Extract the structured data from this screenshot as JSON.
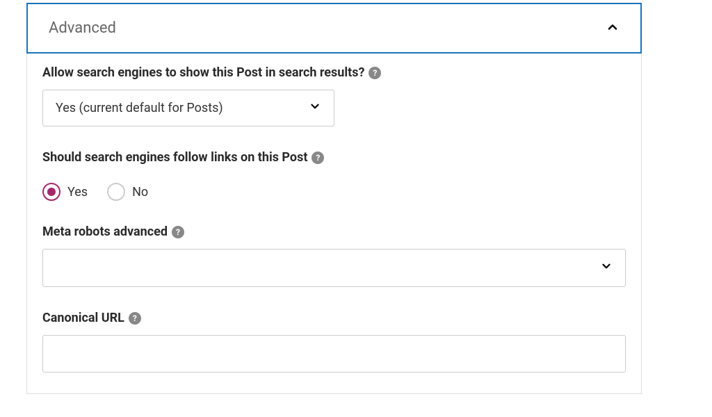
{
  "panel": {
    "title": "Advanced"
  },
  "fields": {
    "allow_search": {
      "label": "Allow search engines to show this Post in search results?",
      "value": "Yes (current default for Posts)"
    },
    "follow_links": {
      "label": "Should search engines follow links on this Post",
      "options": {
        "yes": "Yes",
        "no": "No"
      },
      "selected": "yes"
    },
    "meta_robots": {
      "label": "Meta robots advanced",
      "value": ""
    },
    "canonical": {
      "label": "Canonical URL",
      "value": ""
    }
  }
}
